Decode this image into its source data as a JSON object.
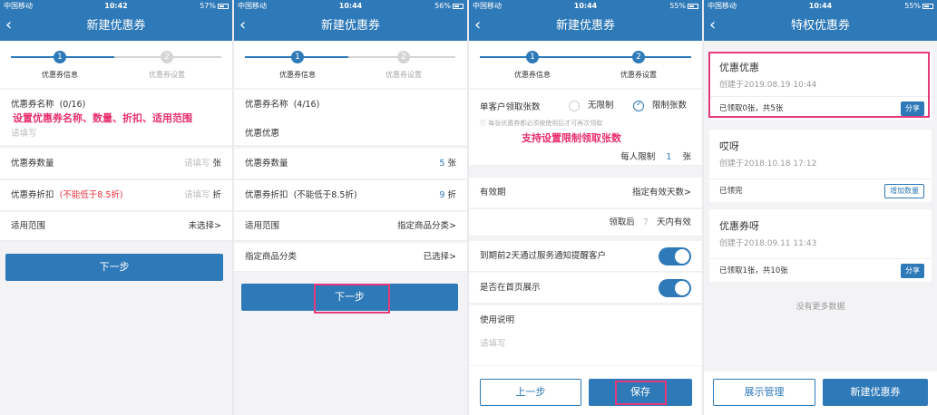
{
  "status_bars": [
    {
      "carrier": "中国移动",
      "time": "10:42",
      "battery": "57%"
    },
    {
      "carrier": "中国移动",
      "time": "10:44",
      "battery": "56%"
    },
    {
      "carrier": "中国移动",
      "time": "10:44",
      "battery": "55%"
    },
    {
      "carrier": "中国移动",
      "time": "10:44",
      "battery": "55%"
    }
  ],
  "screen1": {
    "title": "新建优惠券",
    "step1": "优惠券信息",
    "step2": "优惠券设置",
    "name_label": "优惠券名称",
    "name_count": "(0/16)",
    "name_placeholder": "请填写",
    "annotation": "设置优惠券名称、数量、折扣、适用范围",
    "qty_label": "优惠券数量",
    "qty_placeholder": "请填写",
    "qty_unit": "张",
    "discount_label": "优惠券折扣",
    "discount_note": "(不能低于8.5折)",
    "discount_placeholder": "请填写",
    "discount_unit": "折",
    "scope_label": "适用范围",
    "scope_value": "未选择>",
    "next": "下一步"
  },
  "screen2": {
    "title": "新建优惠券",
    "step1": "优惠券信息",
    "step2": "优惠券设置",
    "name_label": "优惠券名称",
    "name_count": "(4/16)",
    "name_value": "优惠优惠",
    "qty_label": "优惠券数量",
    "qty_value": "5",
    "qty_unit": "张",
    "discount_label": "优惠券折扣",
    "discount_note": "(不能低于8.5折)",
    "discount_value": "9",
    "discount_unit": "折",
    "scope_label": "适用范围",
    "scope_value": "指定商品分类>",
    "category_label": "指定商品分类",
    "category_value": "已选择>",
    "next": "下一步"
  },
  "screen3": {
    "title": "新建优惠券",
    "step1": "优惠券信息",
    "step2": "优惠券设置",
    "limit_label": "单客户领取张数",
    "opt_unlimited": "无限制",
    "opt_limited": "限制张数",
    "limit_tip": "每张优惠券都必须被使用后才可再次领取",
    "annotation": "支持设置限制领取张数",
    "per_person_label": "每人限制",
    "per_person_value": "1",
    "per_person_unit": "张",
    "validity_label": "有效期",
    "validity_value": "指定有效天数>",
    "after_label": "领取后",
    "after_value": "7",
    "after_unit": "天内有效",
    "notify_label": "到期前2天通过服务通知提醒客户",
    "home_label": "是否在首页展示",
    "desc_label": "使用说明",
    "desc_placeholder": "请填写",
    "prev": "上一步",
    "save": "保存"
  },
  "screen4": {
    "title": "特权优惠券",
    "coupons": [
      {
        "name": "优惠优惠",
        "created": "创建于2019.08.19 10:44",
        "stat": "已领取0张，共5张",
        "action": "分享"
      },
      {
        "name": "哎呀",
        "created": "创建于2018.10.18 17:12",
        "stat": "已领完",
        "action": "增加数量"
      },
      {
        "name": "优惠券呀",
        "created": "创建于2018.09.11 11:43",
        "stat": "已领取1张，共10张",
        "action": "分享"
      }
    ],
    "no_more": "没有更多数据",
    "manage": "展示管理",
    "create": "新建优惠券"
  }
}
